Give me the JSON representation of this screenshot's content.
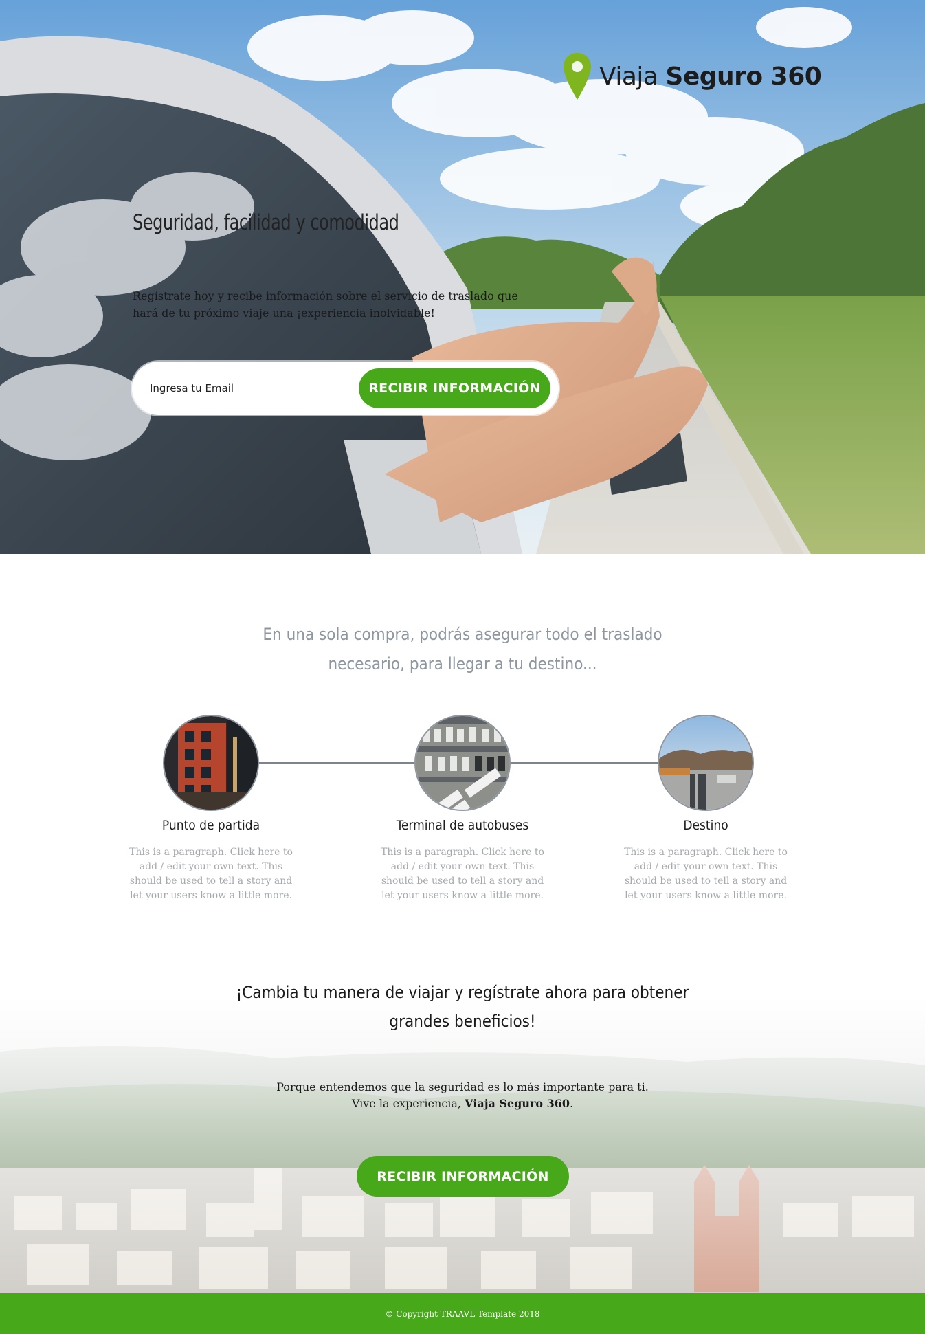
{
  "brand": {
    "name_regular": "Viaja",
    "name_bold": "Seguro 360",
    "accent": "#7fb51e"
  },
  "hero": {
    "title": "Seguridad, facilidad y comodidad",
    "subtitle": "Regístrate hoy y recibe información sobre el servicio de traslado que hará de tu próximo viaje una ¡experiencia inolvidable!",
    "email_placeholder": "Ingresa tu Email",
    "button_label": "RECIBIR INFORMACIÓN"
  },
  "intro": {
    "text": "En una sola compra, podrás asegurar todo el traslado necesario, para llegar a tu destino..."
  },
  "steps": [
    {
      "title": "Punto de partida",
      "text": "This is a paragraph. Click here to add / edit your own text. This should be used to tell a story and let your users know a little more.",
      "image": "building-photo"
    },
    {
      "title": "Terminal de autobuses",
      "text": "This is a paragraph. Click here to add / edit your own text. This should be used to tell a story and let your users know a little more.",
      "image": "bus-terminal-photo"
    },
    {
      "title": "Destino",
      "text": "This is a paragraph. Click here to add / edit your own text. This should be used to tell a story and let your users know a little more.",
      "image": "destination-photo"
    }
  ],
  "cta": {
    "title": "¡Cambia tu manera de viajar y regístrate ahora para obtener grandes beneficios!",
    "line1": "Porque entendemos que la seguridad es lo más importante para ti.",
    "line2_prefix": "Vive la experiencia, ",
    "line2_bold": "Viaja Seguro 360",
    "line2_suffix": ".",
    "button_label": "RECIBIR INFORMACIÓN"
  },
  "footer": {
    "copyright": "© Copyright TRAAVL Template 2018"
  },
  "colors": {
    "green": "#47a81a",
    "muted_text": "#8e96a0",
    "paragraph_gray": "#a5a9ae"
  }
}
